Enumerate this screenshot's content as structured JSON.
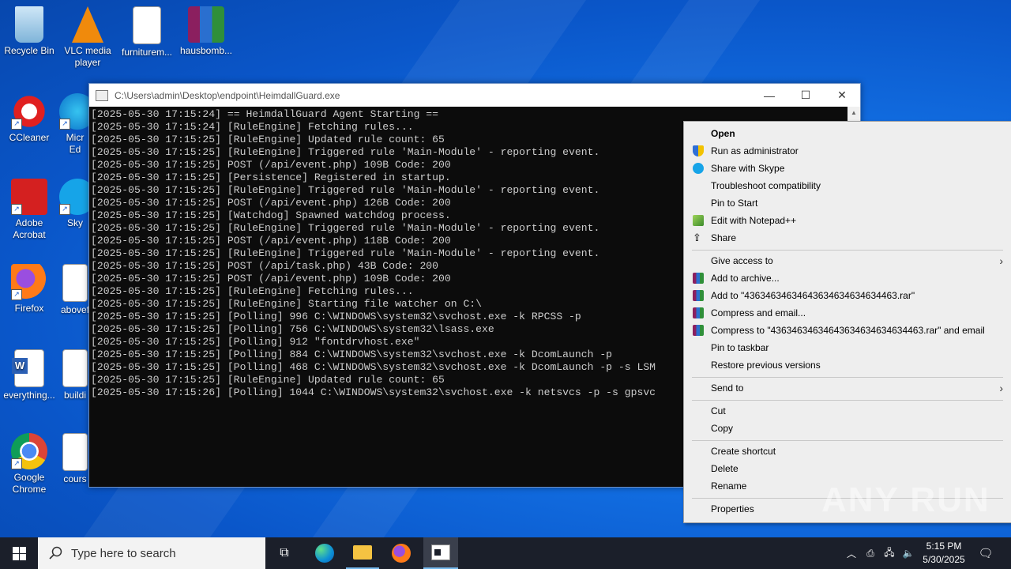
{
  "desktop": {
    "icons": [
      {
        "label": "Recycle Bin"
      },
      {
        "label": "VLC media player"
      },
      {
        "label": "furniturem..."
      },
      {
        "label": "hausbomb..."
      },
      {
        "label": "CCleaner"
      },
      {
        "label": "Micr Ed"
      },
      {
        "label": "Adobe Acrobat"
      },
      {
        "label": "Sky"
      },
      {
        "label": "Firefox"
      },
      {
        "label": "abovef"
      },
      {
        "label": "everything..."
      },
      {
        "label": "buildi"
      },
      {
        "label": "Google Chrome"
      },
      {
        "label": "cours"
      }
    ]
  },
  "console": {
    "title": "C:\\Users\\admin\\Desktop\\endpoint\\HeimdallGuard.exe",
    "lines": [
      "[2025-05-30 17:15:24] == HeimdallGuard Agent Starting ==",
      "[2025-05-30 17:15:24] [RuleEngine] Fetching rules...",
      "[2025-05-30 17:15:25] [RuleEngine] Updated rule count: 65",
      "[2025-05-30 17:15:25] [RuleEngine] Triggered rule 'Main-Module' - reporting event.",
      "[2025-05-30 17:15:25] POST (/api/event.php) 109B Code: 200",
      "[2025-05-30 17:15:25] [Persistence] Registered in startup.",
      "[2025-05-30 17:15:25] [RuleEngine] Triggered rule 'Main-Module' - reporting event.",
      "[2025-05-30 17:15:25] POST (/api/event.php) 126B Code: 200",
      "[2025-05-30 17:15:25] [Watchdog] Spawned watchdog process.",
      "[2025-05-30 17:15:25] [RuleEngine] Triggered rule 'Main-Module' - reporting event.",
      "[2025-05-30 17:15:25] POST (/api/event.php) 118B Code: 200",
      "[2025-05-30 17:15:25] [RuleEngine] Triggered rule 'Main-Module' - reporting event.",
      "[2025-05-30 17:15:25] POST (/api/task.php) 43B Code: 200",
      "[2025-05-30 17:15:25] POST (/api/event.php) 109B Code: 200",
      "[2025-05-30 17:15:25] [RuleEngine] Fetching rules...",
      "[2025-05-30 17:15:25] [RuleEngine] Starting file watcher on C:\\",
      "[2025-05-30 17:15:25] [Polling] 996 C:\\WINDOWS\\system32\\svchost.exe -k RPCSS -p",
      "[2025-05-30 17:15:25] [Polling] 756 C:\\WINDOWS\\system32\\lsass.exe",
      "[2025-05-30 17:15:25] [Polling] 912 \"fontdrvhost.exe\"",
      "[2025-05-30 17:15:25] [Polling] 884 C:\\WINDOWS\\system32\\svchost.exe -k DcomLaunch -p",
      "[2025-05-30 17:15:25] [Polling] 468 C:\\WINDOWS\\system32\\svchost.exe -k DcomLaunch -p -s LSM",
      "[2025-05-30 17:15:25] [RuleEngine] Updated rule count: 65",
      "[2025-05-30 17:15:26] [Polling] 1044 C:\\WINDOWS\\system32\\svchost.exe -k netsvcs -p -s gpsvc"
    ]
  },
  "context_menu": {
    "items": [
      {
        "label": "Open",
        "icon": "none"
      },
      {
        "label": "Run as administrator",
        "icon": "shield-icon"
      },
      {
        "label": "Share with Skype",
        "icon": "skype-icon"
      },
      {
        "label": "Troubleshoot compatibility",
        "icon": "none"
      },
      {
        "label": "Pin to Start",
        "icon": "none"
      },
      {
        "label": "Edit with Notepad++",
        "icon": "notepadpp-icon"
      },
      {
        "label": "Share",
        "icon": "share-icon"
      },
      {
        "label": "Give access to",
        "icon": "none"
      },
      {
        "label": "Add to archive...",
        "icon": "winrar-icon"
      },
      {
        "label": "Add to \"43634634634643634634634634463.rar\"",
        "icon": "winrar-icon"
      },
      {
        "label": "Compress and email...",
        "icon": "winrar-icon"
      },
      {
        "label": "Compress to \"43634634634643634634634634463.rar\" and email",
        "icon": "winrar-icon"
      },
      {
        "label": "Pin to taskbar",
        "icon": "none"
      },
      {
        "label": "Restore previous versions",
        "icon": "none"
      },
      {
        "label": "Send to",
        "icon": "none"
      },
      {
        "label": "Cut",
        "icon": "none"
      },
      {
        "label": "Copy",
        "icon": "none"
      },
      {
        "label": "Create shortcut",
        "icon": "none"
      },
      {
        "label": "Delete",
        "icon": "none"
      },
      {
        "label": "Rename",
        "icon": "none"
      },
      {
        "label": "Properties",
        "icon": "none"
      }
    ]
  },
  "taskbar": {
    "search_placeholder": "Type here to search",
    "time": "5:15 PM",
    "date": "5/30/2025"
  },
  "watermark": "ANY RUN",
  "colors": {
    "desktop_blue": "#0a56c9",
    "console_bg": "#0c0c0c",
    "console_text": "#cccccc",
    "menu_bg": "#eeeeee",
    "taskbar_bg": "#1b1f2a"
  }
}
